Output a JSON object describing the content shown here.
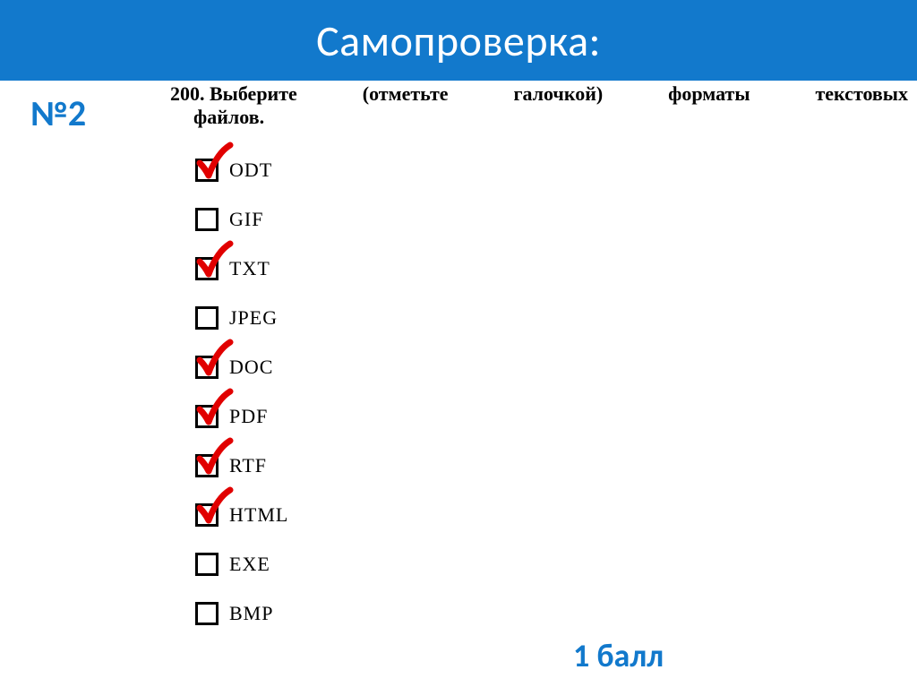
{
  "header": {
    "title": "Самопроверка:"
  },
  "slide": {
    "question_marker": "№2",
    "task_number": "200.",
    "prompt_words": [
      "Выберите",
      "(отметьте",
      "галочкой)",
      "форматы",
      "текстовых"
    ],
    "prompt_cont": "файлов.",
    "score": "1 балл"
  },
  "options": [
    {
      "label": "ODT",
      "checked": true
    },
    {
      "label": "GIF",
      "checked": false
    },
    {
      "label": "TXT",
      "checked": true
    },
    {
      "label": "JPEG",
      "checked": false
    },
    {
      "label": "DOC",
      "checked": true
    },
    {
      "label": "PDF",
      "checked": true
    },
    {
      "label": "RTF",
      "checked": true
    },
    {
      "label": "HTML",
      "checked": true
    },
    {
      "label": "EXE",
      "checked": false
    },
    {
      "label": "BMP",
      "checked": false
    }
  ],
  "colors": {
    "accent": "#1279cc",
    "check": "#e10000"
  }
}
